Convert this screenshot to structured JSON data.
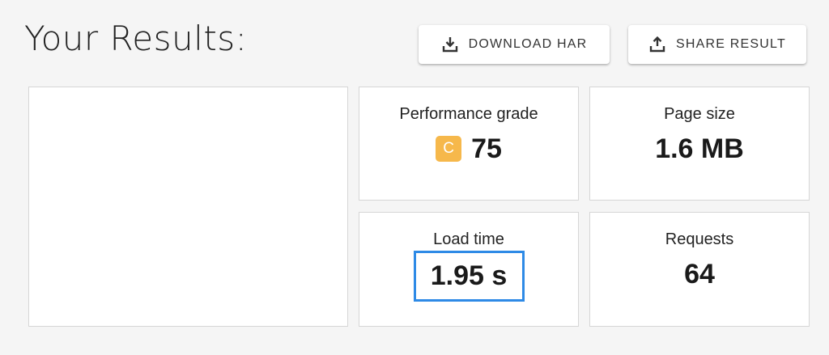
{
  "header": {
    "title": "Your Results:"
  },
  "actions": {
    "download_label": "DOWNLOAD HAR",
    "download_icon": "download-icon",
    "share_label": "SHARE RESULT",
    "share_icon": "share-upload-icon"
  },
  "metrics": {
    "performance_grade": {
      "label": "Performance grade",
      "letter": "C",
      "score": "75",
      "badge_color": "#f6b84b"
    },
    "page_size": {
      "label": "Page size",
      "value": "1.6 MB"
    },
    "load_time": {
      "label": "Load time",
      "value": "1.95 s",
      "highlight_color": "#2e8ae6"
    },
    "requests": {
      "label": "Requests",
      "value": "64"
    }
  }
}
